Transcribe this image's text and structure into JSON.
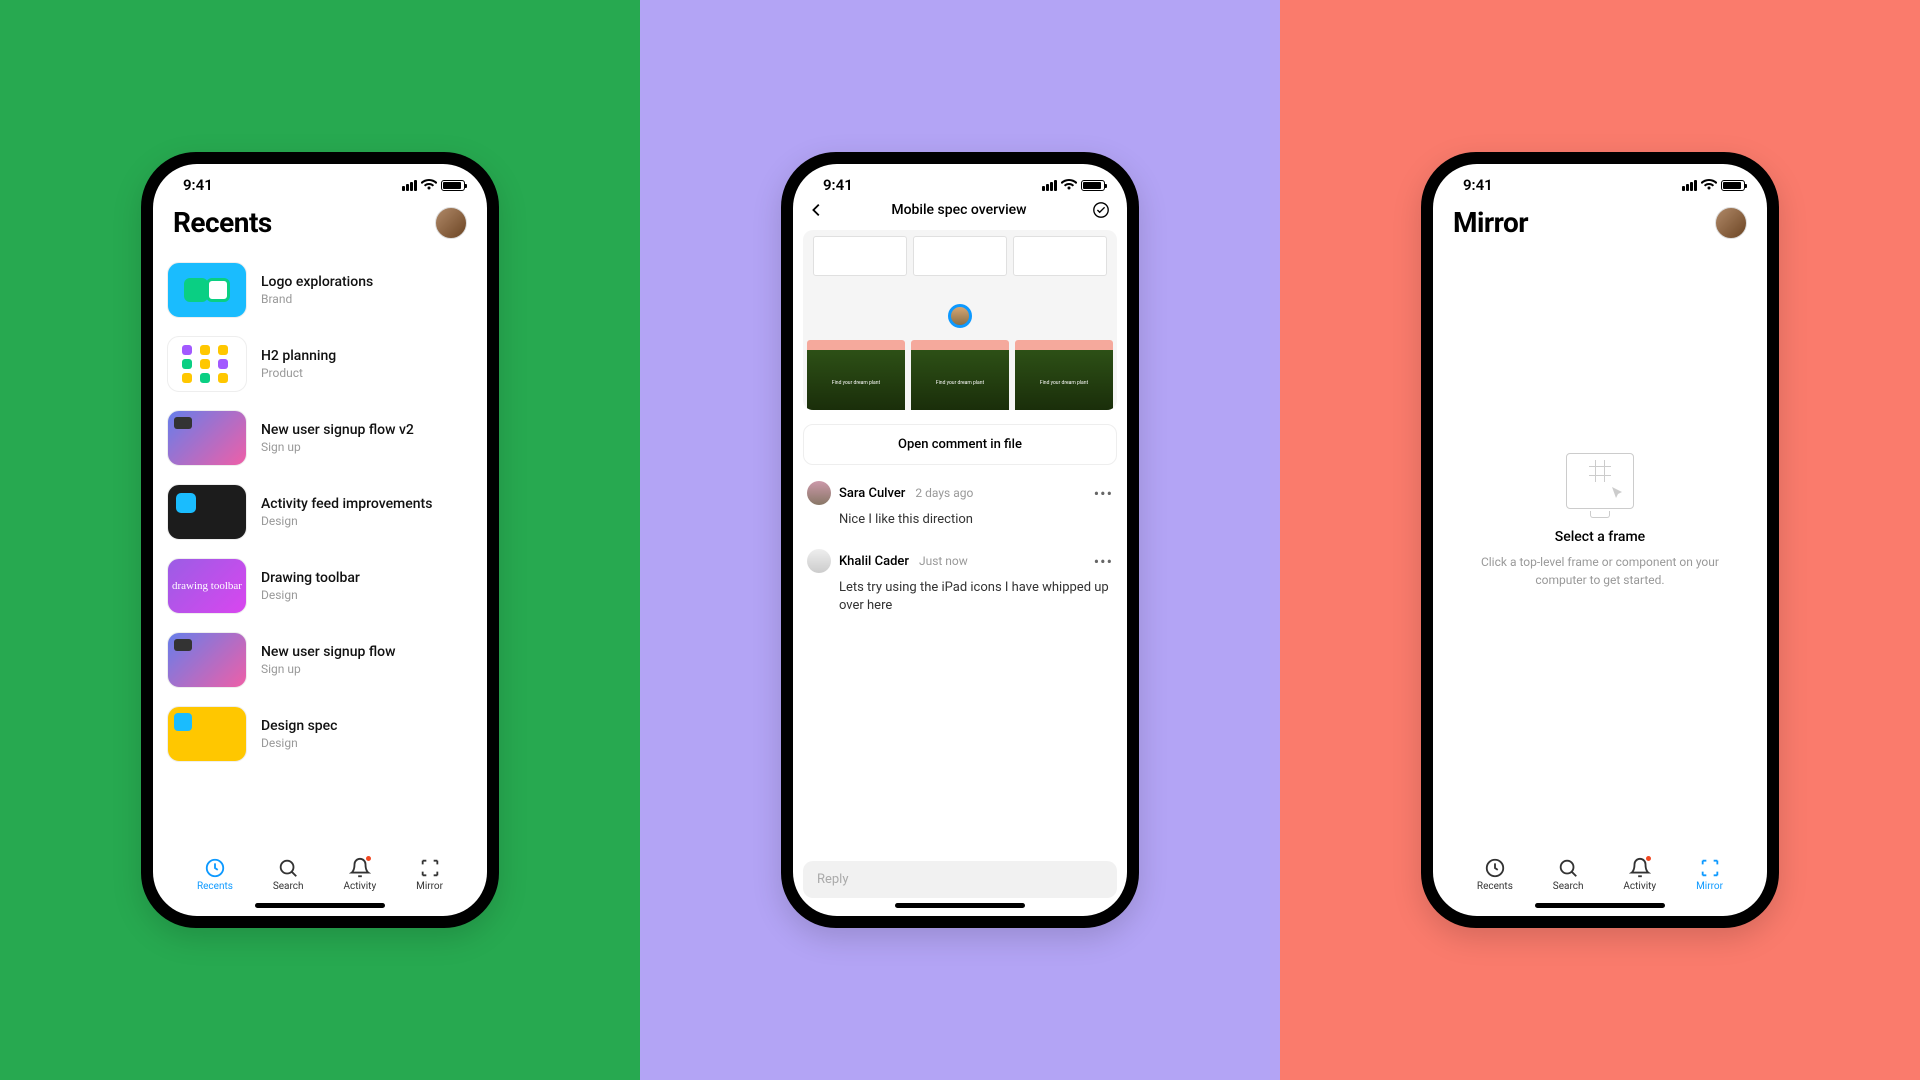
{
  "status": {
    "time": "9:41"
  },
  "panel1": {
    "title": "Recents",
    "items": [
      {
        "title": "Logo explorations",
        "sub": "Brand",
        "thumb": "logo"
      },
      {
        "title": "H2 planning",
        "sub": "Product",
        "thumb": "planning"
      },
      {
        "title": "New user signup flow v2",
        "sub": "Sign up",
        "thumb": "signup"
      },
      {
        "title": "Activity feed improvements",
        "sub": "Design",
        "thumb": "activity"
      },
      {
        "title": "Drawing toolbar",
        "sub": "Design",
        "thumb": "drawing",
        "thumbText": "drawing toolbar"
      },
      {
        "title": "New user signup flow",
        "sub": "Sign up",
        "thumb": "signup"
      },
      {
        "title": "Design spec",
        "sub": "Design",
        "thumb": "spec"
      }
    ],
    "tabs": {
      "recents": "Recents",
      "search": "Search",
      "activity": "Activity",
      "mirror": "Mirror"
    },
    "activeTab": "recents"
  },
  "panel2": {
    "navTitle": "Mobile spec overview",
    "openButton": "Open comment in file",
    "plantTagline": "Find your dream plant",
    "comments": [
      {
        "name": "Sara Culver",
        "time": "2 days ago",
        "body": "Nice I like this direction"
      },
      {
        "name": "Khalil Cader",
        "time": "Just now",
        "body": "Lets try using the iPad icons I have whipped up over here"
      }
    ],
    "replyPlaceholder": "Reply"
  },
  "panel3": {
    "title": "Mirror",
    "emptyTitle": "Select a frame",
    "emptyDesc": "Click a top-level frame or component on your computer to get started.",
    "activeTab": "mirror"
  }
}
